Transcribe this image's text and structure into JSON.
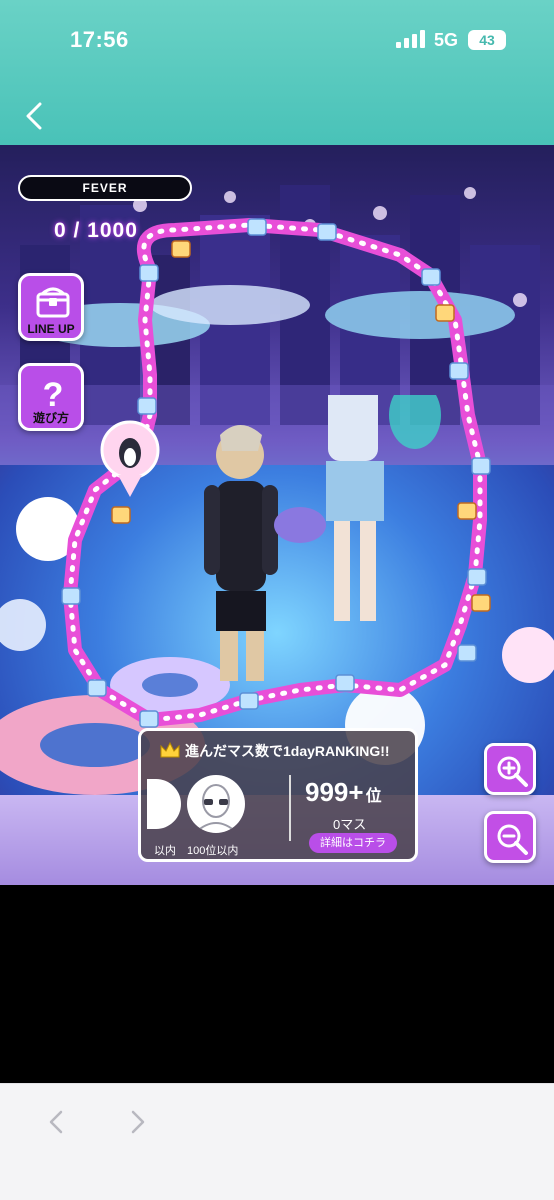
{
  "status_bar": {
    "time": "17:56",
    "network": "5G",
    "battery": "43"
  },
  "header": {
    "back_icon": "chevron-left-icon"
  },
  "game": {
    "fever": {
      "label": "FEVER",
      "count": "0 / 1000"
    },
    "side_buttons": {
      "lineup_label": "LINE UP",
      "howto_label": "遊び方"
    },
    "ranking": {
      "title": "進んだマス数で1dayRANKING!!",
      "left_label": "以内",
      "avatar_label": "100位以内",
      "my_rank": "999+",
      "my_rank_suffix": "位",
      "my_squares": "0マス",
      "detail_button": "詳細はコチラ"
    },
    "zoom_in_icon": "zoom-in-icon",
    "zoom_out_icon": "zoom-out-icon"
  },
  "colors": {
    "header_teal": "#49c2b8",
    "accent_purple": "#b94ee8",
    "track_magenta": "#e84fd8"
  }
}
